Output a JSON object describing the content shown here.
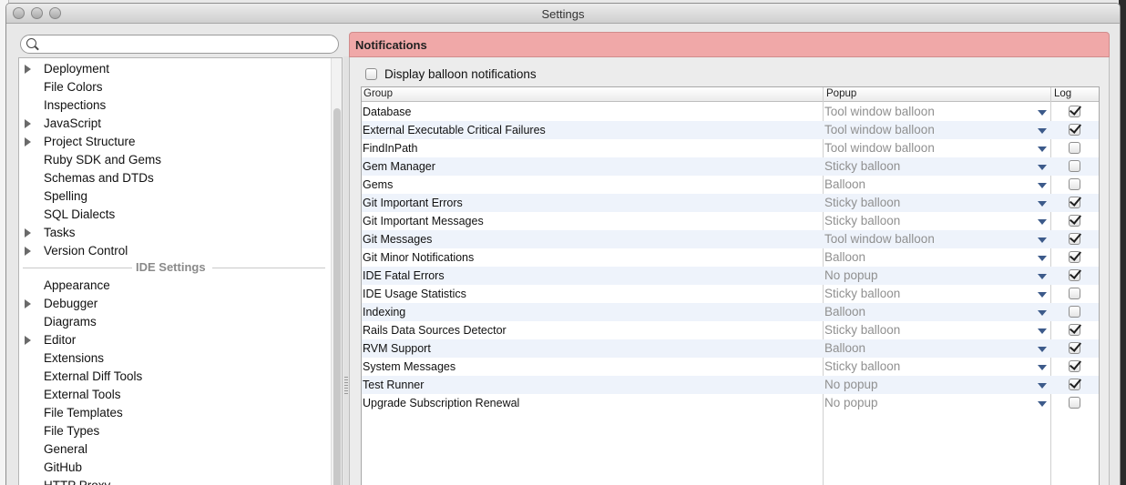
{
  "window": {
    "title": "Settings"
  },
  "search": {
    "placeholder": "",
    "value": ""
  },
  "tree": {
    "project_items": [
      {
        "label": "Deployment",
        "expandable": true
      },
      {
        "label": "File Colors",
        "expandable": false
      },
      {
        "label": "Inspections",
        "expandable": false
      },
      {
        "label": "JavaScript",
        "expandable": true
      },
      {
        "label": "Project Structure",
        "expandable": true
      },
      {
        "label": "Ruby SDK and Gems",
        "expandable": false
      },
      {
        "label": "Schemas and DTDs",
        "expandable": false
      },
      {
        "label": "Spelling",
        "expandable": false
      },
      {
        "label": "SQL Dialects",
        "expandable": false
      },
      {
        "label": "Tasks",
        "expandable": true
      },
      {
        "label": "Version Control",
        "expandable": true
      }
    ],
    "ide_section_label": "IDE Settings",
    "ide_items": [
      {
        "label": "Appearance",
        "expandable": false
      },
      {
        "label": "Debugger",
        "expandable": true
      },
      {
        "label": "Diagrams",
        "expandable": false
      },
      {
        "label": "Editor",
        "expandable": true
      },
      {
        "label": "Extensions",
        "expandable": false
      },
      {
        "label": "External Diff Tools",
        "expandable": false
      },
      {
        "label": "External Tools",
        "expandable": false
      },
      {
        "label": "File Templates",
        "expandable": false
      },
      {
        "label": "File Types",
        "expandable": false
      },
      {
        "label": "General",
        "expandable": false
      },
      {
        "label": "GitHub",
        "expandable": false
      },
      {
        "label": "HTTP Proxy",
        "expandable": false
      }
    ]
  },
  "notifications": {
    "header": "Notifications",
    "balloon_label": "Display balloon notifications",
    "balloon_checked": false,
    "columns": {
      "group": "Group",
      "popup": "Popup",
      "log": "Log"
    },
    "rows": [
      {
        "group": "Database",
        "popup": "Tool window balloon",
        "log": true
      },
      {
        "group": "External Executable Critical Failures",
        "popup": "Tool window balloon",
        "log": true
      },
      {
        "group": "FindInPath",
        "popup": "Tool window balloon",
        "log": false
      },
      {
        "group": "Gem Manager",
        "popup": "Sticky balloon",
        "log": false
      },
      {
        "group": "Gems",
        "popup": "Balloon",
        "log": false
      },
      {
        "group": "Git Important Errors",
        "popup": "Sticky balloon",
        "log": true
      },
      {
        "group": "Git Important Messages",
        "popup": "Sticky balloon",
        "log": true
      },
      {
        "group": "Git Messages",
        "popup": "Tool window balloon",
        "log": true
      },
      {
        "group": "Git Minor Notifications",
        "popup": "Balloon",
        "log": true
      },
      {
        "group": "IDE Fatal Errors",
        "popup": "No popup",
        "log": true
      },
      {
        "group": "IDE Usage Statistics",
        "popup": "Sticky balloon",
        "log": false
      },
      {
        "group": "Indexing",
        "popup": "Balloon",
        "log": false
      },
      {
        "group": "Rails Data Sources Detector",
        "popup": "Sticky balloon",
        "log": true
      },
      {
        "group": "RVM Support",
        "popup": "Balloon",
        "log": true
      },
      {
        "group": "System Messages",
        "popup": "Sticky balloon",
        "log": true
      },
      {
        "group": "Test Runner",
        "popup": "No popup",
        "log": true
      },
      {
        "group": "Upgrade Subscription Renewal",
        "popup": "No popup",
        "log": false
      }
    ]
  },
  "colors": {
    "header_bg": "#f0a8a8",
    "dropdown_arrow": "#3c5a8a",
    "alt_row": "#eef3fb"
  }
}
